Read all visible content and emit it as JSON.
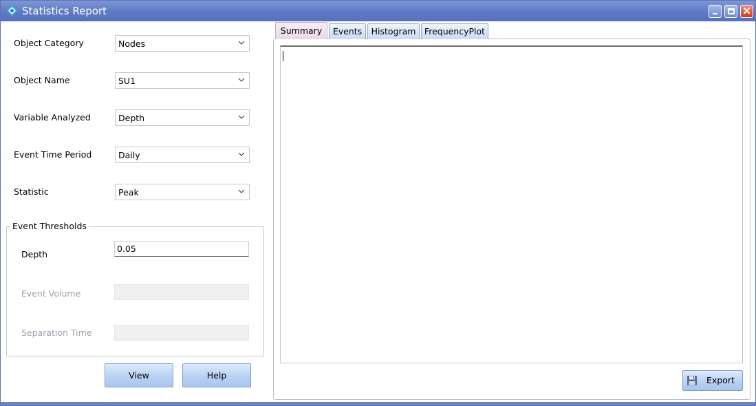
{
  "window": {
    "title": "Statistics Report",
    "icon": "app-icon"
  },
  "form": {
    "object_category": {
      "label": "Object Category",
      "value": "Nodes"
    },
    "object_name": {
      "label": "Object Name",
      "value": "SU1"
    },
    "variable_analyzed": {
      "label": "Variable Analyzed",
      "value": "Depth"
    },
    "event_time_period": {
      "label": "Event Time Period",
      "value": "Daily"
    },
    "statistic": {
      "label": "Statistic",
      "value": "Peak"
    }
  },
  "thresholds": {
    "title": "Event Thresholds",
    "depth": {
      "label": "Depth",
      "value": "0.05"
    },
    "event_volume": {
      "label": "Event Volume",
      "value": ""
    },
    "separation_time": {
      "label": "Separation Time",
      "value": ""
    }
  },
  "buttons": {
    "view": "View",
    "help": "Help",
    "export": "Export"
  },
  "tabs": [
    {
      "label": "Summary",
      "active": true
    },
    {
      "label": "Events",
      "active": false
    },
    {
      "label": "Histogram",
      "active": false
    },
    {
      "label": "FrequencyPlot",
      "active": false
    }
  ],
  "colors": {
    "titlebar": "#6a82c7",
    "button": "#b9d1f3",
    "active_tab": "#ead7e6"
  }
}
